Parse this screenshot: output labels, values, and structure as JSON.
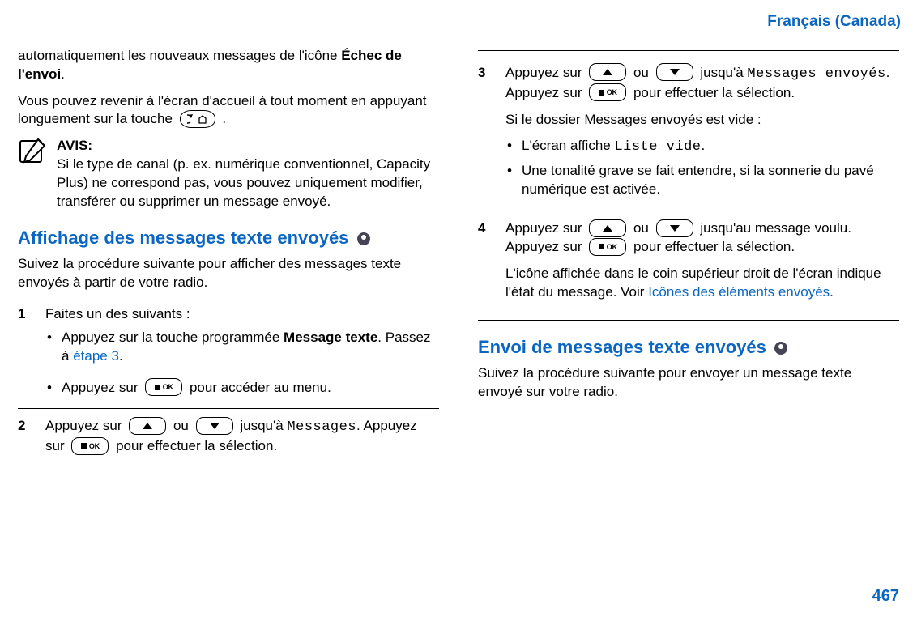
{
  "header": {
    "language": "Français (Canada)"
  },
  "page_number": "467",
  "left": {
    "intro_frag_1": "automatiquement les nouveaux messages de l'icône ",
    "intro_frag_bold": "Échec de l'envoi",
    "intro_frag_2": ".",
    "return_prefix": "Vous pouvez revenir à l'écran d'accueil à tout moment en appuyant longuement sur la touche ",
    "return_suffix": " .",
    "notice": {
      "title": "AVIS:",
      "body": "Si le type de canal (p. ex. numérique conventionnel, Capacity Plus) ne correspond pas, vous pouvez uniquement modifier, transférer ou supprimer un message envoyé."
    },
    "heading": "Affichage des messages texte envoyés",
    "lead": "Suivez la procédure suivante pour afficher des messages texte envoyés à partir de votre radio.",
    "steps": {
      "s1": {
        "num": "1",
        "text": "Faites un des suivants :",
        "bullets": {
          "b1_a": "Appuyez sur la touche programmée ",
          "b1_bold": "Message texte",
          "b1_b": ". Passez à ",
          "b1_link": "étape 3",
          "b1_c": ".",
          "b2_a": "Appuyez sur ",
          "b2_b": " pour accéder au menu."
        }
      },
      "s2": {
        "num": "2",
        "a": "Appuyez sur ",
        "b": " ou ",
        "c": " jusqu'à ",
        "target": "Messages",
        "d": ". Appuyez sur ",
        "e": " pour effectuer la sélection."
      }
    }
  },
  "right": {
    "steps": {
      "s3": {
        "num": "3",
        "a": "Appuyez sur ",
        "b": " ou ",
        "c": " jusqu'à ",
        "target": "Messages envoyés",
        "d": ". Appuyez sur ",
        "e": " pour effectuer la sélection.",
        "empty_intro": "Si le dossier Messages envoyés est vide :",
        "bullets": {
          "b1_a": "L'écran affiche ",
          "b1_mono": "Liste vide",
          "b1_b": ".",
          "b2": "Une tonalité grave se fait entendre, si la sonnerie du pavé numérique est activée."
        }
      },
      "s4": {
        "num": "4",
        "a": "Appuyez sur ",
        "b": " ou ",
        "c": " jusqu'au message voulu. Appuyez sur ",
        "d": " pour effectuer la sélection.",
        "p2_a": "L'icône affichée dans le coin supérieur droit de l'écran indique l'état du message. Voir ",
        "p2_link": "Icônes des éléments envoyés",
        "p2_b": "."
      }
    },
    "heading2": "Envoi de messages texte envoyés",
    "lead2": "Suivez la procédure suivante pour envoyer un message texte envoyé sur votre radio."
  }
}
